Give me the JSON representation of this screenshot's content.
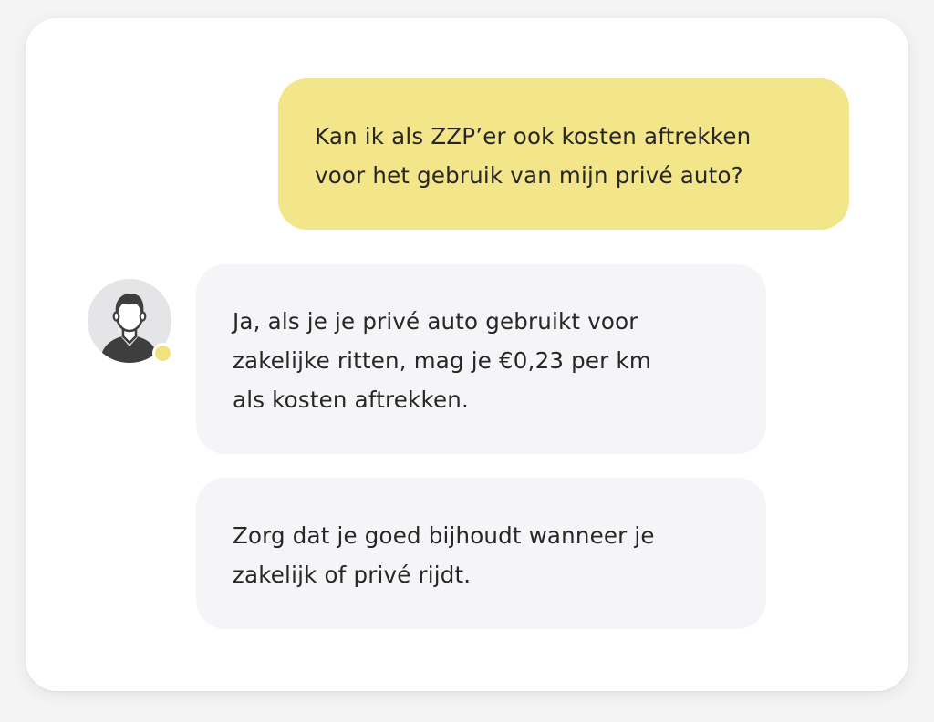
{
  "conversation": {
    "user_message": {
      "lines": [
        "Kan ik als ZZP’er ook kosten aftrekken",
        "voor het gebruik van mijn privé auto?"
      ]
    },
    "assistant": {
      "avatar_icon": "user-avatar-icon",
      "status_color": "#f0e27e",
      "messages": [
        {
          "lines": [
            "Ja, als je je privé auto gebruikt voor",
            "zakelijke ritten, mag je €0,23 per km",
            "als kosten aftrekken."
          ]
        },
        {
          "lines": [
            "Zorg dat je goed bijhoudt wanneer je",
            "zakelijk of privé rijdt."
          ]
        }
      ]
    }
  },
  "colors": {
    "user_bubble": "#f3e58a",
    "assistant_bubble": "#f5f5f8",
    "card": "#ffffff",
    "text": "#262626"
  }
}
